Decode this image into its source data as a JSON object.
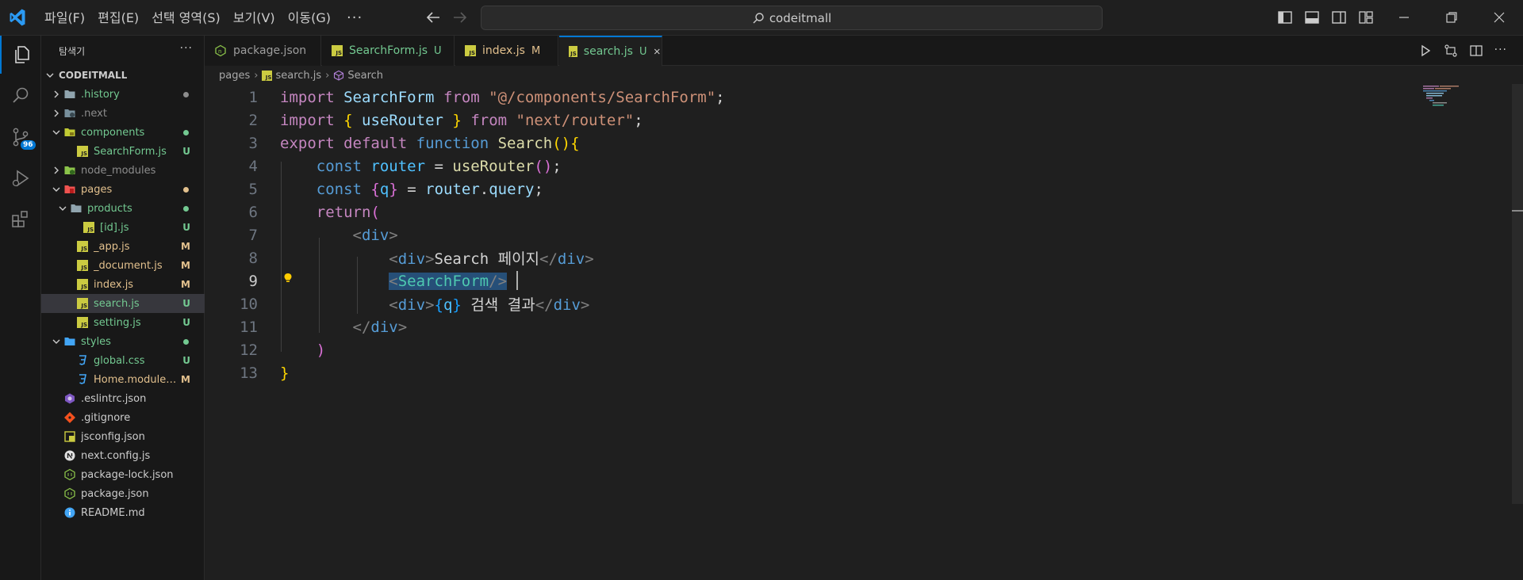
{
  "app": {
    "search_text": "codeitmall",
    "menu": [
      "파일(F)",
      "편집(E)",
      "선택 영역(S)",
      "보기(V)",
      "이동(G)"
    ],
    "menu_more": "···"
  },
  "activity": {
    "scm_badge": "96"
  },
  "sidebar": {
    "title": "탐색기",
    "more": "···",
    "root": "CODEITMALL",
    "items": [
      {
        "label": ".history",
        "deco": "",
        "dot": true
      },
      {
        "label": ".next",
        "deco": "",
        "dot": false
      },
      {
        "label": "components",
        "deco": "",
        "dot": true
      },
      {
        "label": "SearchForm.js",
        "deco": "U",
        "dot": false
      },
      {
        "label": "node_modules",
        "deco": "",
        "dot": false
      },
      {
        "label": "pages",
        "deco": "",
        "dot": true
      },
      {
        "label": "products",
        "deco": "",
        "dot": true
      },
      {
        "label": "[id].js",
        "deco": "U",
        "dot": false
      },
      {
        "label": "_app.js",
        "deco": "M",
        "dot": false
      },
      {
        "label": "_document.js",
        "deco": "M",
        "dot": false
      },
      {
        "label": "index.js",
        "deco": "M",
        "dot": false
      },
      {
        "label": "search.js",
        "deco": "U",
        "dot": false
      },
      {
        "label": "setting.js",
        "deco": "U",
        "dot": false
      },
      {
        "label": "styles",
        "deco": "",
        "dot": true
      },
      {
        "label": "global.css",
        "deco": "U",
        "dot": false
      },
      {
        "label": "Home.module....",
        "deco": "M",
        "dot": false
      },
      {
        "label": ".eslintrc.json",
        "deco": "",
        "dot": false
      },
      {
        "label": ".gitignore",
        "deco": "",
        "dot": false
      },
      {
        "label": "jsconfig.json",
        "deco": "",
        "dot": false
      },
      {
        "label": "next.config.js",
        "deco": "",
        "dot": false
      },
      {
        "label": "package-lock.json",
        "deco": "",
        "dot": false
      },
      {
        "label": "package.json",
        "deco": "",
        "dot": false
      },
      {
        "label": "README.md",
        "deco": "",
        "dot": false
      }
    ]
  },
  "tabs": [
    {
      "label": "package.json",
      "deco": ""
    },
    {
      "label": "SearchForm.js",
      "deco": "U"
    },
    {
      "label": "index.js",
      "deco": "M"
    },
    {
      "label": "search.js",
      "deco": "U"
    }
  ],
  "breadcrumb": [
    "pages",
    "search.js",
    "Search"
  ],
  "editor": {
    "line_numbers": [
      "1",
      "2",
      "3",
      "4",
      "5",
      "6",
      "7",
      "8",
      "9",
      "10",
      "11",
      "12",
      "13"
    ],
    "active_line": "9"
  },
  "colors": {
    "accent": "#0078d4",
    "untracked": "#73c991",
    "modified": "#e2c08d",
    "js_icon": "#cbcb41"
  }
}
